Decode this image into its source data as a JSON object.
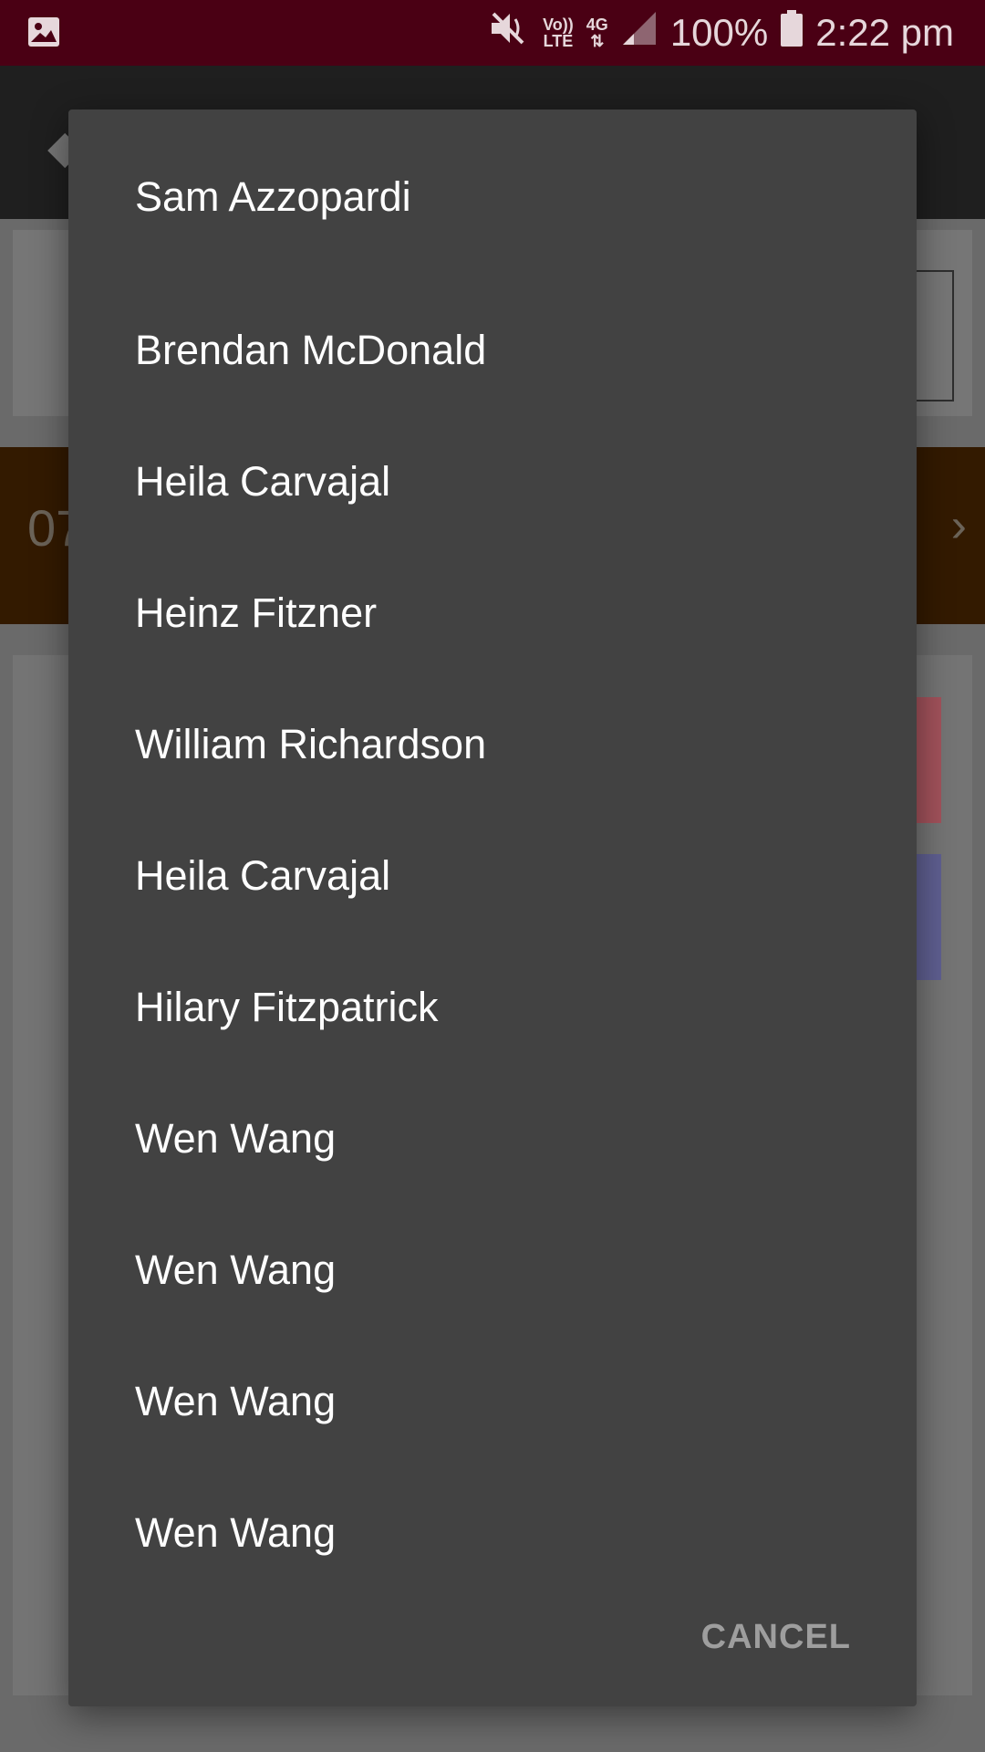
{
  "status_bar": {
    "time": "2:22 pm",
    "battery": "100%",
    "volte_top": "Vo))",
    "volte_bottom": "LTE",
    "network": "4G",
    "icons": [
      "image-icon",
      "mute-icon",
      "signal-icon",
      "battery-icon"
    ]
  },
  "background": {
    "date_partial": "07"
  },
  "dialog": {
    "items": [
      "Sam Azzopardi",
      "Brendan McDonald",
      "Heila Carvajal",
      "Heinz Fitzner",
      "William Richardson",
      "Heila Carvajal",
      "Hilary Fitzpatrick",
      "Wen Wang",
      "Wen Wang",
      "Wen Wang",
      "Wen Wang"
    ],
    "cancel_label": "CANCEL"
  },
  "colors": {
    "status_bar": "#4a0014",
    "dialog_bg": "#424242",
    "scrim": "#6b6b6b"
  }
}
